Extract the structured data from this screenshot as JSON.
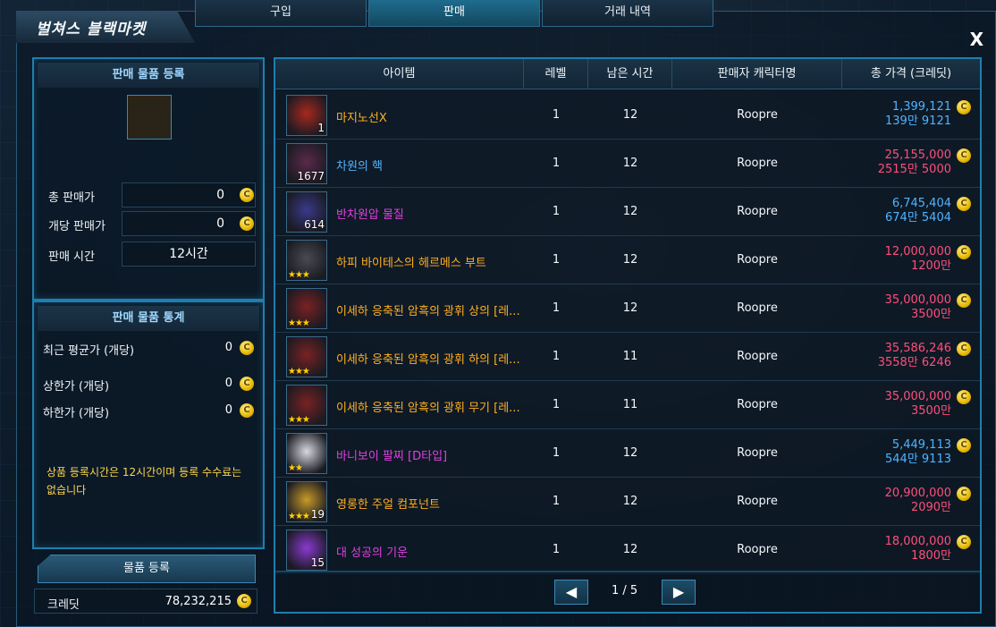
{
  "title": "벌쳐스 블랙마켓",
  "tabs": [
    {
      "label": "구입",
      "active": false
    },
    {
      "label": "판매",
      "active": true
    },
    {
      "label": "거래 내역",
      "active": false
    }
  ],
  "close_label": "X",
  "register_panel": {
    "heading": "판매 물품 등록",
    "total_price_label": "총 판매가",
    "total_price_value": "0",
    "unit_price_label": "개당 판매가",
    "unit_price_value": "0",
    "sale_time_label": "판매 시간",
    "sale_time_value": "12시간"
  },
  "stats_panel": {
    "heading": "판매 물품 통계",
    "recent_avg_label": "최근 평균가 (개당)",
    "recent_avg_value": "0",
    "max_label": "상한가 (개당)",
    "max_value": "0",
    "min_label": "하한가 (개당)",
    "min_value": "0"
  },
  "notice": "상품 등록시간은 12시간이며 등록 수수료는 없습니다",
  "register_button": "물품 등록",
  "credit": {
    "label": "크레딧",
    "value": "78,232,215"
  },
  "table": {
    "headers": [
      "아이템",
      "레벨",
      "남은 시간",
      "판매자 캐릭터명",
      "총 가격 (크레딧)"
    ],
    "rows": [
      {
        "name": "마지노선X",
        "qty": "1",
        "stars": "",
        "level": "1",
        "time": "12",
        "seller": "Roopre",
        "price": "1,399,121",
        "price_kr": "139만 9121",
        "name_color": "#ffb020",
        "price_color": "#4fb4ff"
      },
      {
        "name": "차원의 핵",
        "qty": "1677",
        "stars": "",
        "level": "1",
        "time": "12",
        "seller": "Roopre",
        "price": "25,155,000",
        "price_kr": "2515만 5000",
        "name_color": "#4fb4ff",
        "price_color": "#ff4f7a"
      },
      {
        "name": "반차원압 물질",
        "qty": "614",
        "stars": "",
        "level": "1",
        "time": "12",
        "seller": "Roopre",
        "price": "6,745,404",
        "price_kr": "674만 5404",
        "name_color": "#e040e0",
        "price_color": "#4fb4ff"
      },
      {
        "name": "하피 바이테스의 헤르메스 부트",
        "qty": "",
        "stars": "★★★",
        "level": "1",
        "time": "12",
        "seller": "Roopre",
        "price": "12,000,000",
        "price_kr": "1200만",
        "name_color": "#ffb020",
        "price_color": "#ff4f7a"
      },
      {
        "name": "이세하 응축된 암흑의 광휘 상의 [레...",
        "qty": "",
        "stars": "★★★",
        "level": "1",
        "time": "12",
        "seller": "Roopre",
        "price": "35,000,000",
        "price_kr": "3500만",
        "name_color": "#ffb020",
        "price_color": "#ff4f7a"
      },
      {
        "name": "이세하 응축된 암흑의 광휘 하의 [레...",
        "qty": "",
        "stars": "★★★",
        "level": "1",
        "time": "11",
        "seller": "Roopre",
        "price": "35,586,246",
        "price_kr": "3558만 6246",
        "name_color": "#ffb020",
        "price_color": "#ff4f7a"
      },
      {
        "name": "이세하 응축된 암흑의 광휘 무기 [레...",
        "qty": "",
        "stars": "★★★",
        "level": "1",
        "time": "11",
        "seller": "Roopre",
        "price": "35,000,000",
        "price_kr": "3500만",
        "name_color": "#ffb020",
        "price_color": "#ff4f7a"
      },
      {
        "name": "바니보이 팔찌 [D타입]",
        "qty": "",
        "stars": "★★",
        "level": "1",
        "time": "12",
        "seller": "Roopre",
        "price": "5,449,113",
        "price_kr": "544만 9113",
        "name_color": "#e040e0",
        "price_color": "#4fb4ff"
      },
      {
        "name": "영롱한 주얼 컴포넌트",
        "qty": "19",
        "stars": "★★★",
        "level": "1",
        "time": "12",
        "seller": "Roopre",
        "price": "20,900,000",
        "price_kr": "2090만",
        "name_color": "#ffb020",
        "price_color": "#ff4f7a"
      },
      {
        "name": "대 성공의 기운",
        "qty": "15",
        "stars": "",
        "level": "1",
        "time": "12",
        "seller": "Roopre",
        "price": "18,000,000",
        "price_kr": "1800만",
        "name_color": "#e040e0",
        "price_color": "#ff4f7a"
      }
    ]
  },
  "pager": {
    "prev": "◀",
    "next": "▶",
    "text": "1 / 5"
  },
  "coin_glyph": "C"
}
